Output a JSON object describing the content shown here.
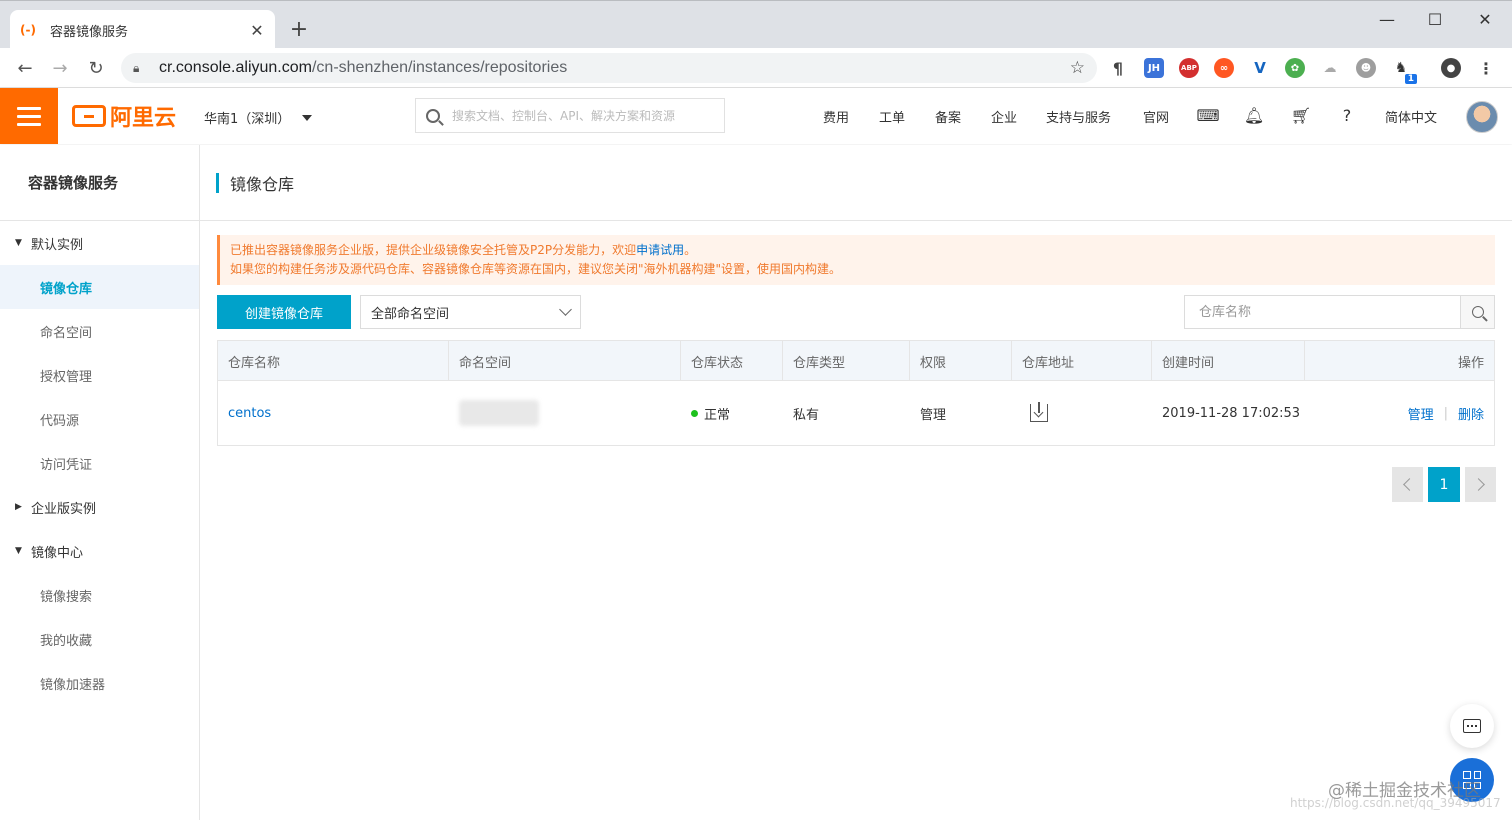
{
  "browser": {
    "tab_title": "容器镜像服务",
    "url_host": "cr.console.aliyun.com",
    "url_path": "/cn-shenzhen/instances/repositories",
    "extensions": [
      "paragraph-icon",
      "jh-icon",
      "abp-icon",
      "infinity-icon",
      "vue-icon",
      "chrome-ext-icon",
      "cloud-icon",
      "ext-face-icon",
      "ext-badge-icon"
    ],
    "ext_badge_count": "1"
  },
  "topbar": {
    "logo_text": "阿里云",
    "region": "华南1（深圳）",
    "search_placeholder": "搜索文档、控制台、API、解决方案和资源",
    "links": [
      "费用",
      "工单",
      "备案",
      "企业",
      "支持与服务",
      "官网"
    ],
    "language": "简体中文"
  },
  "sidebar": {
    "title": "容器镜像服务",
    "groups": [
      {
        "label": "默认实例",
        "expanded": true,
        "items": [
          "镜像仓库",
          "命名空间",
          "授权管理",
          "代码源",
          "访问凭证"
        ]
      },
      {
        "label": "企业版实例",
        "expanded": false,
        "items": []
      },
      {
        "label": "镜像中心",
        "expanded": true,
        "items": [
          "镜像搜索",
          "我的收藏",
          "镜像加速器"
        ]
      }
    ],
    "active_item": "镜像仓库"
  },
  "main": {
    "page_title": "镜像仓库",
    "notice": {
      "line1_prefix": "已推出容器镜像服务企业版，提供企业级镜像安全托管及P2P分发能力，欢迎",
      "line1_link": "申请试用",
      "line1_suffix": "。",
      "line2": "如果您的构建任务涉及源代码仓库、容器镜像仓库等资源在国内，建议您关闭\"海外机器构建\"设置，使用国内构建。"
    },
    "create_button": "创建镜像仓库",
    "namespace_select": "全部命名空间",
    "repo_search_placeholder": "仓库名称",
    "table": {
      "columns": [
        "仓库名称",
        "命名空间",
        "仓库状态",
        "仓库类型",
        "权限",
        "仓库地址",
        "创建时间",
        "操作"
      ],
      "rows": [
        {
          "name": "centos",
          "namespace": "",
          "status": "正常",
          "type": "私有",
          "permission": "管理",
          "created": "2019-11-28 17:02:53",
          "action_manage": "管理",
          "action_delete": "删除"
        }
      ]
    },
    "pagination": {
      "current": "1"
    }
  },
  "colors": {
    "brand": "#ff6a00",
    "accent": "#00a2ca",
    "link": "#0070cc",
    "status_ok": "#1dc11d"
  },
  "watermark": "@稀土掘金技术社区",
  "watermark_url": "https://blog.csdn.net/qq_39495017"
}
